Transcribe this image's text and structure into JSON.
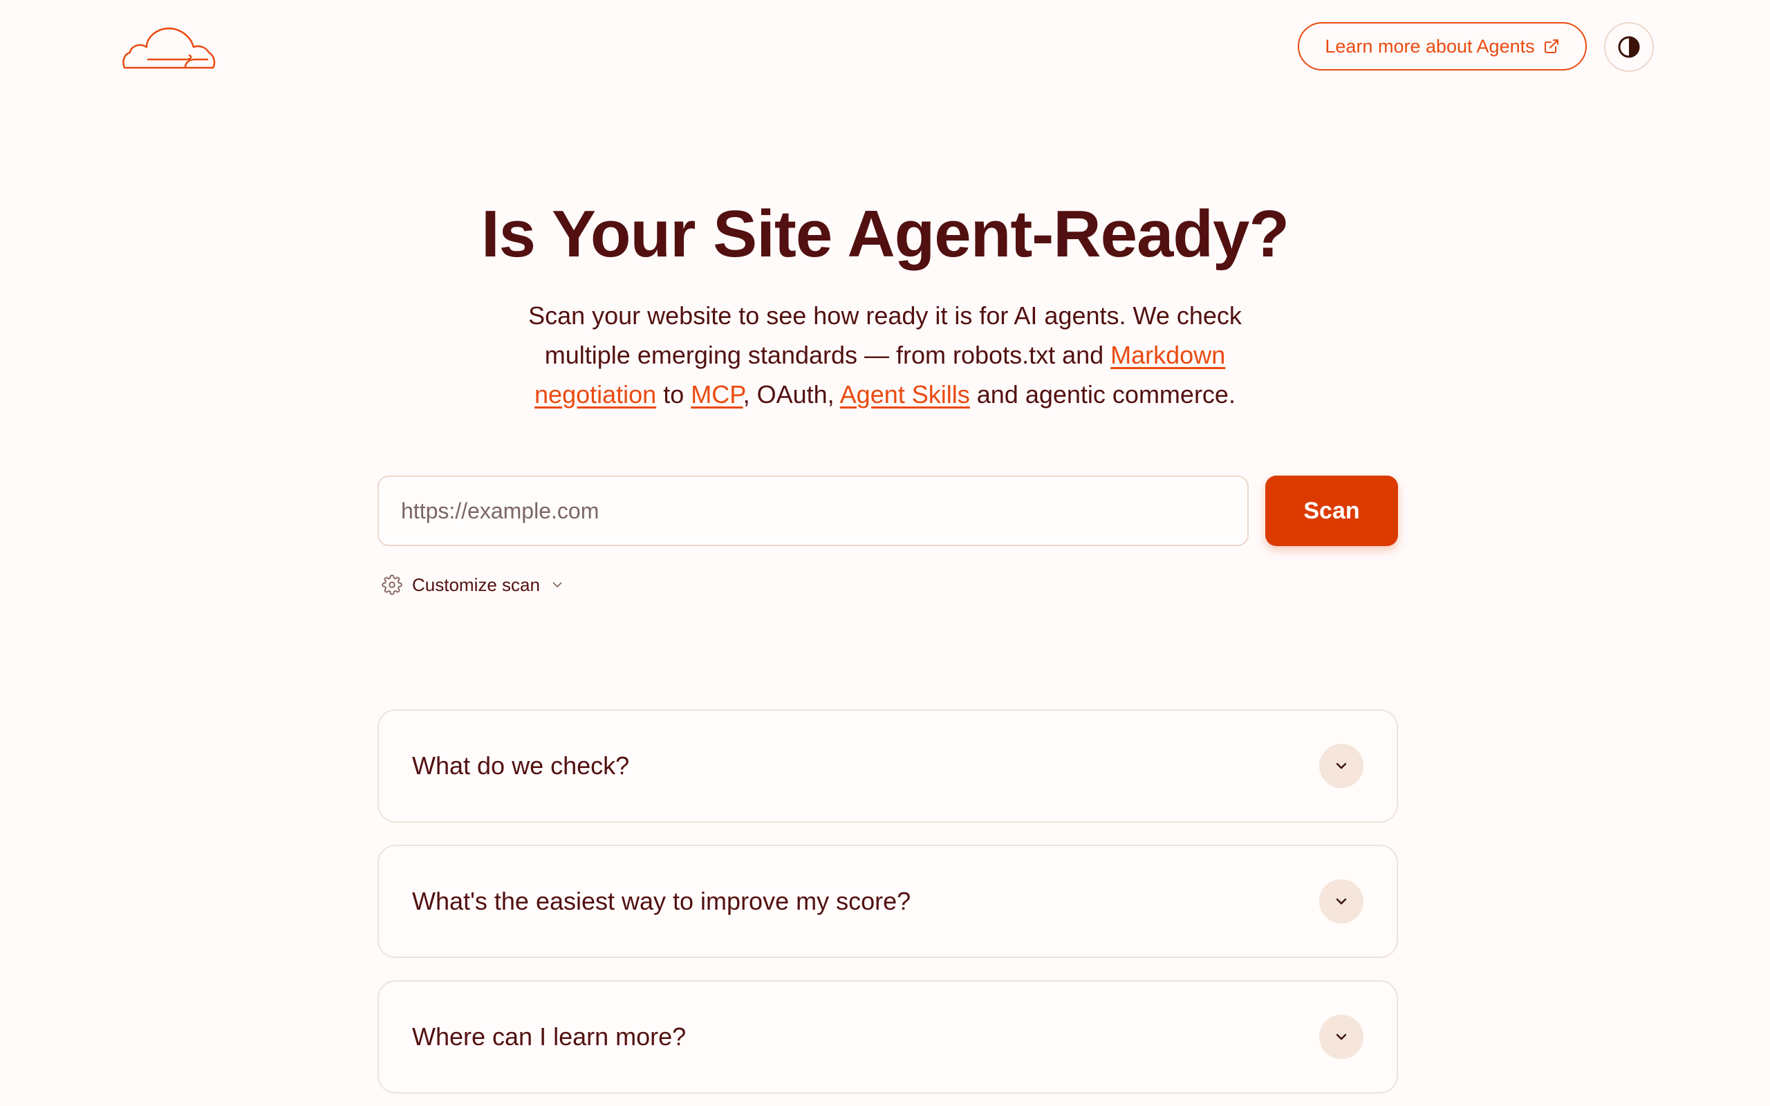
{
  "header": {
    "logo_icon": "cloudflare-cloud-logo",
    "learn_more_label": "Learn more about Agents",
    "external_icon": "external-link-icon",
    "theme_toggle_icon": "contrast-icon"
  },
  "hero": {
    "title": "Is Your Site Agent-Ready?",
    "desc_1": "Scan your website to see how ready it is for AI agents. We check multiple emerging standards — from robots.txt and ",
    "link_markdown": "Markdown negotiation",
    "desc_2": " to ",
    "link_mcp": "MCP",
    "desc_3": ", OAuth, ",
    "link_skills": "Agent Skills",
    "desc_4": " and agentic commerce."
  },
  "search": {
    "placeholder": "https://example.com",
    "value": "",
    "scan_label": "Scan",
    "customize_label": "Customize scan"
  },
  "faq": [
    {
      "question": "What do we check?"
    },
    {
      "question": "What's the easiest way to improve my score?"
    },
    {
      "question": "Where can I learn more?"
    }
  ],
  "colors": {
    "accent": "#ea4a10",
    "button": "#dc3b00",
    "text": "#521010",
    "background": "#fffbfa"
  }
}
